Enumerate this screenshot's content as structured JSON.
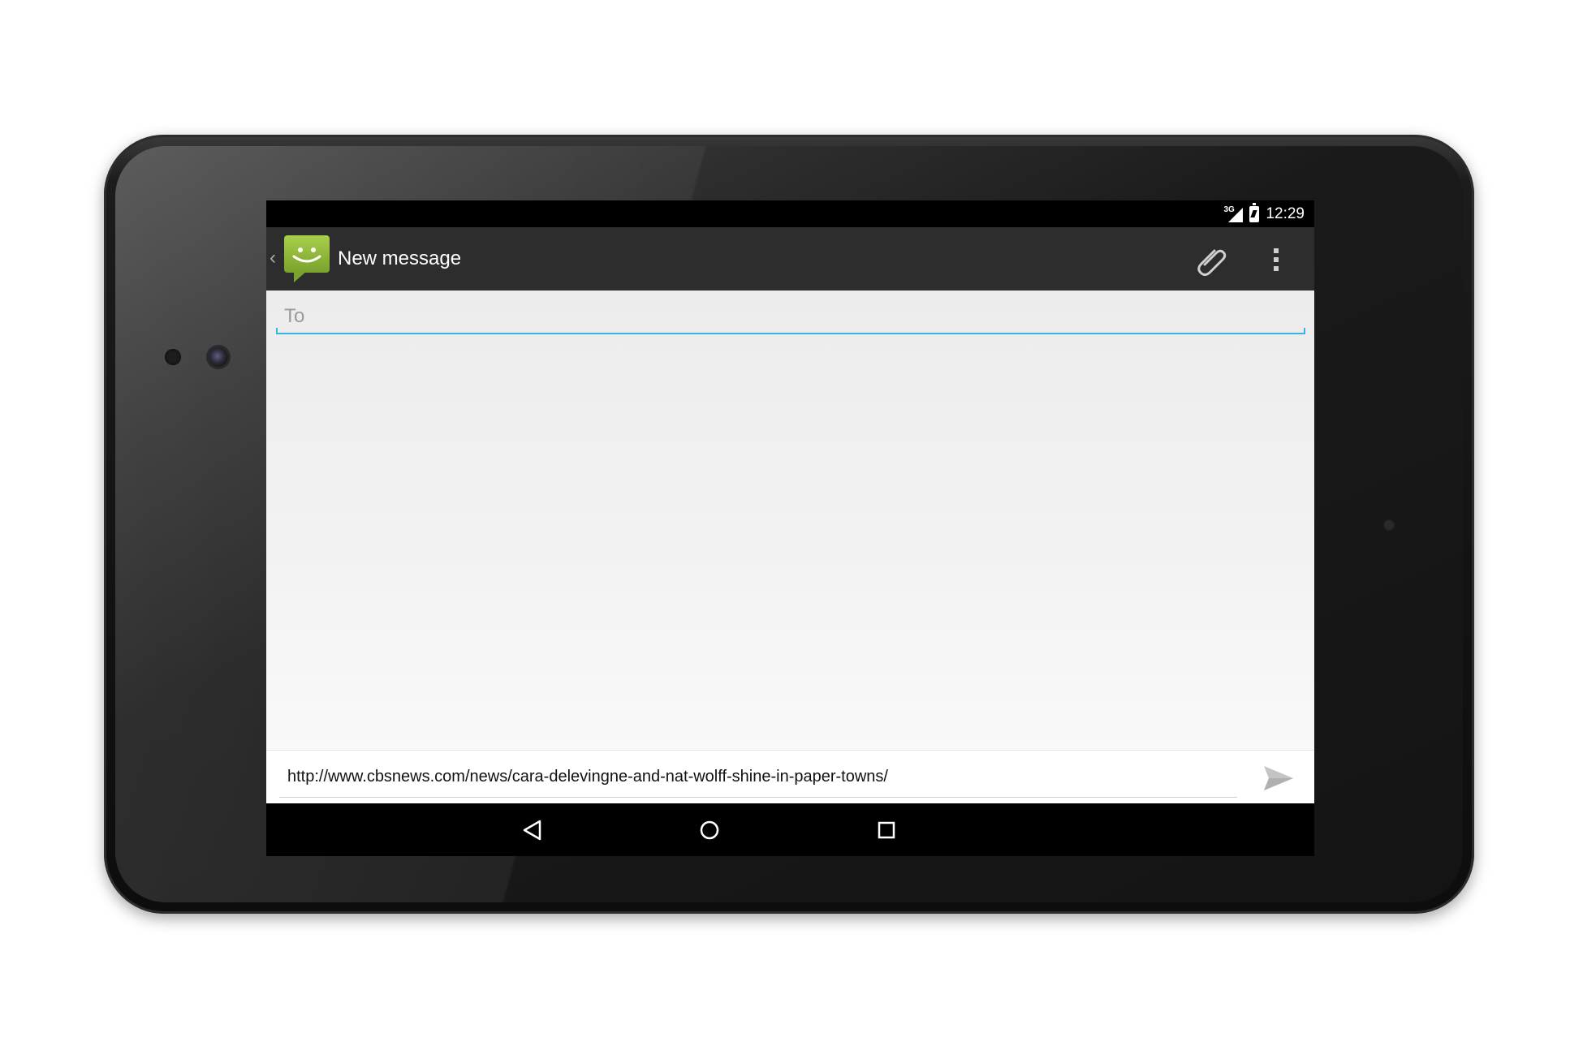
{
  "status_bar": {
    "network_label": "3G",
    "time": "12:29"
  },
  "action_bar": {
    "title": "New message",
    "app_icon": "messaging-smiley-icon",
    "actions": [
      "paperclip-icon",
      "overflow-menu-icon"
    ]
  },
  "compose": {
    "to_placeholder": "To",
    "message_text": "http://www.cbsnews.com/news/cara-delevingne-and-nat-wolff-shine-in-paper-towns/",
    "send_icon": "send-icon"
  },
  "nav_bar": {
    "buttons": [
      "back-icon",
      "home-icon",
      "recents-icon"
    ]
  },
  "colors": {
    "accent": "#33b5e5",
    "app_icon_green": "#8fb93a",
    "action_bar": "#2d2d2d"
  }
}
